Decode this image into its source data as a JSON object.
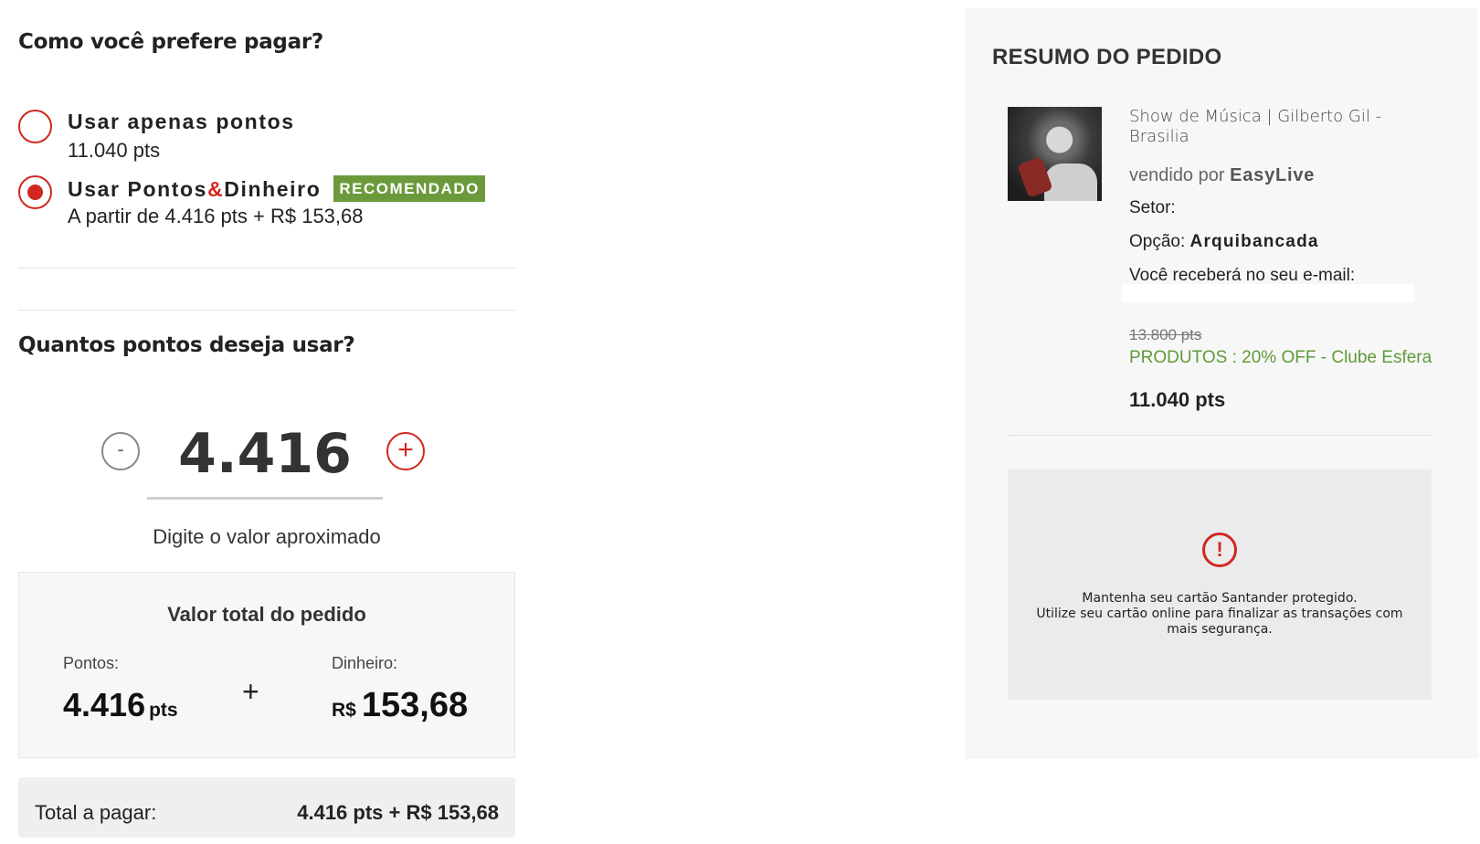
{
  "payment": {
    "question": "Como você prefere pagar?",
    "options": [
      {
        "title": "Usar apenas pontos",
        "subtitle": "11.040 pts",
        "selected": false
      },
      {
        "title_part1": "Usar Pontos",
        "title_amp": "&",
        "title_part2": "Dinheiro",
        "badge": "RECOMENDADO",
        "subtitle": "A partir de 4.416 pts + R$ 153,68",
        "selected": true
      }
    ]
  },
  "points": {
    "question": "Quantos pontos deseja usar?",
    "minus_label": "-",
    "plus_label": "+",
    "value": "4.416",
    "hint": "Digite o valor aproximado"
  },
  "order_total": {
    "title": "Valor total do pedido",
    "points_label": "Pontos:",
    "points_value": "4.416",
    "points_unit": "pts",
    "plus": "+",
    "money_label": "Dinheiro:",
    "money_currency": "R$",
    "money_value": "153,68"
  },
  "pay": {
    "label": "Total a pagar:",
    "value": "4.416 pts + R$ 153,68"
  },
  "summary": {
    "title": "RESUMO DO PEDIDO",
    "product_name": "Show de Música | Gilberto Gil - Brasilia",
    "seller_prefix": "vendido por",
    "seller_name": "EasyLive",
    "setor_label": "Setor:",
    "opcao_label": "Opção:",
    "opcao_value": "Arquibancada",
    "email_label": "Você receberá no seu e-mail:",
    "old_points": "13.800 pts",
    "promo": "PRODUTOS : 20% OFF - Clube Esfera",
    "points_total": "11.040 pts"
  },
  "alert": {
    "icon": "exclamation-icon",
    "icon_glyph": "!",
    "line1": "Mantenha seu cartão Santander protegido.",
    "line2": "Utilize seu cartão online para finalizar as transações com mais segurança."
  },
  "colors": {
    "accent_red": "#d0281f",
    "badge_green": "#6b9a3c",
    "promo_green": "#5f9a3a"
  }
}
